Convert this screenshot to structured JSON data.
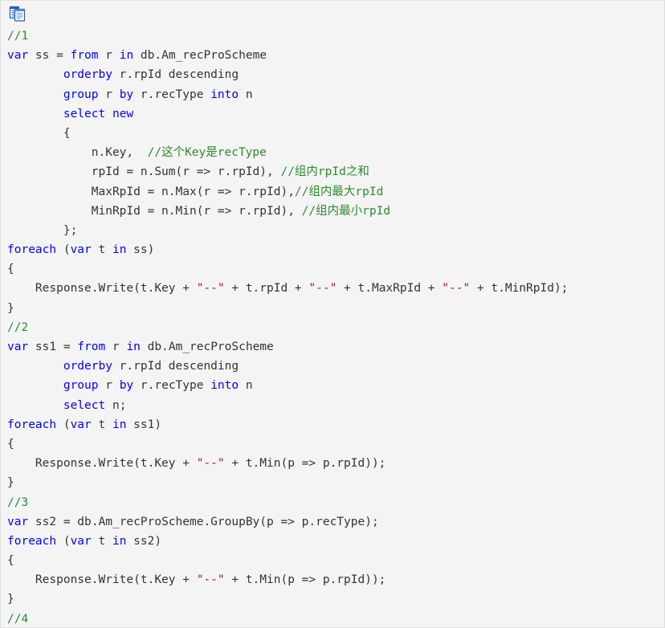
{
  "viewer": {
    "background": "#f4f4f4",
    "border_color": "#dddddd",
    "language": "csharp"
  },
  "toolbar": {
    "copy_icon_name": "copy-to-clipboard-icon",
    "copy_icon_title": "复制代码",
    "accent": "#2a5db0"
  },
  "palette": {
    "keyword": "#0000ff",
    "comment": "#2e8b2e",
    "string": "#a31515",
    "plain": "#333333"
  },
  "code": {
    "lines": [
      [
        {
          "t": "//1",
          "c": "cm"
        }
      ],
      [
        {
          "t": "var",
          "c": "k"
        },
        {
          "t": " ss = ",
          "c": "pl"
        },
        {
          "t": "from",
          "c": "k"
        },
        {
          "t": " r ",
          "c": "pl"
        },
        {
          "t": "in",
          "c": "k"
        },
        {
          "t": " db.Am_recProScheme",
          "c": "pl"
        }
      ],
      [
        {
          "t": "        ",
          "c": "pl"
        },
        {
          "t": "orderby",
          "c": "k"
        },
        {
          "t": " r.rpId descending",
          "c": "pl"
        }
      ],
      [
        {
          "t": "        ",
          "c": "pl"
        },
        {
          "t": "group",
          "c": "k"
        },
        {
          "t": " r ",
          "c": "pl"
        },
        {
          "t": "by",
          "c": "k"
        },
        {
          "t": " r.recType ",
          "c": "pl"
        },
        {
          "t": "into",
          "c": "k"
        },
        {
          "t": " n",
          "c": "pl"
        }
      ],
      [
        {
          "t": "        ",
          "c": "pl"
        },
        {
          "t": "select",
          "c": "k"
        },
        {
          "t": " ",
          "c": "pl"
        },
        {
          "t": "new",
          "c": "k"
        }
      ],
      [
        {
          "t": "        {",
          "c": "pl"
        }
      ],
      [
        {
          "t": "            n.Key,  ",
          "c": "pl"
        },
        {
          "t": "//这个Key是recType",
          "c": "cm"
        }
      ],
      [
        {
          "t": "            rpId = n.Sum(r => r.rpId), ",
          "c": "pl"
        },
        {
          "t": "//组内rpId之和",
          "c": "cm"
        }
      ],
      [
        {
          "t": "            MaxRpId = n.Max(r => r.rpId),",
          "c": "pl"
        },
        {
          "t": "//组内最大rpId",
          "c": "cm"
        }
      ],
      [
        {
          "t": "            MinRpId = n.Min(r => r.rpId), ",
          "c": "pl"
        },
        {
          "t": "//组内最小rpId",
          "c": "cm"
        }
      ],
      [
        {
          "t": "        };",
          "c": "pl"
        }
      ],
      [
        {
          "t": "foreach",
          "c": "k"
        },
        {
          "t": " (",
          "c": "pl"
        },
        {
          "t": "var",
          "c": "k"
        },
        {
          "t": " t ",
          "c": "pl"
        },
        {
          "t": "in",
          "c": "k"
        },
        {
          "t": " ss)",
          "c": "pl"
        }
      ],
      [
        {
          "t": "{",
          "c": "pl"
        }
      ],
      [
        {
          "t": "    Response.Write(t.Key + ",
          "c": "pl"
        },
        {
          "t": "\"--\"",
          "c": "st"
        },
        {
          "t": " + t.rpId + ",
          "c": "pl"
        },
        {
          "t": "\"--\"",
          "c": "st"
        },
        {
          "t": " + t.MaxRpId + ",
          "c": "pl"
        },
        {
          "t": "\"--\"",
          "c": "st"
        },
        {
          "t": " + t.MinRpId);",
          "c": "pl"
        }
      ],
      [
        {
          "t": "}",
          "c": "pl"
        }
      ],
      [
        {
          "t": "//2",
          "c": "cm"
        }
      ],
      [
        {
          "t": "var",
          "c": "k"
        },
        {
          "t": " ss1 = ",
          "c": "pl"
        },
        {
          "t": "from",
          "c": "k"
        },
        {
          "t": " r ",
          "c": "pl"
        },
        {
          "t": "in",
          "c": "k"
        },
        {
          "t": " db.Am_recProScheme",
          "c": "pl"
        }
      ],
      [
        {
          "t": "        ",
          "c": "pl"
        },
        {
          "t": "orderby",
          "c": "k"
        },
        {
          "t": " r.rpId descending",
          "c": "pl"
        }
      ],
      [
        {
          "t": "        ",
          "c": "pl"
        },
        {
          "t": "group",
          "c": "k"
        },
        {
          "t": " r ",
          "c": "pl"
        },
        {
          "t": "by",
          "c": "k"
        },
        {
          "t": " r.recType ",
          "c": "pl"
        },
        {
          "t": "into",
          "c": "k"
        },
        {
          "t": " n",
          "c": "pl"
        }
      ],
      [
        {
          "t": "        ",
          "c": "pl"
        },
        {
          "t": "select",
          "c": "k"
        },
        {
          "t": " n;",
          "c": "pl"
        }
      ],
      [
        {
          "t": "foreach",
          "c": "k"
        },
        {
          "t": " (",
          "c": "pl"
        },
        {
          "t": "var",
          "c": "k"
        },
        {
          "t": " t ",
          "c": "pl"
        },
        {
          "t": "in",
          "c": "k"
        },
        {
          "t": " ss1)",
          "c": "pl"
        }
      ],
      [
        {
          "t": "{",
          "c": "pl"
        }
      ],
      [
        {
          "t": "    Response.Write(t.Key + ",
          "c": "pl"
        },
        {
          "t": "\"--\"",
          "c": "st"
        },
        {
          "t": " + t.Min(p => p.rpId));",
          "c": "pl"
        }
      ],
      [
        {
          "t": "}",
          "c": "pl"
        }
      ],
      [
        {
          "t": "//3",
          "c": "cm"
        }
      ],
      [
        {
          "t": "var",
          "c": "k"
        },
        {
          "t": " ss2 = db.Am_recProScheme.GroupBy(p => p.recType);",
          "c": "pl"
        }
      ],
      [
        {
          "t": "foreach",
          "c": "k"
        },
        {
          "t": " (",
          "c": "pl"
        },
        {
          "t": "var",
          "c": "k"
        },
        {
          "t": " t ",
          "c": "pl"
        },
        {
          "t": "in",
          "c": "k"
        },
        {
          "t": " ss2)",
          "c": "pl"
        }
      ],
      [
        {
          "t": "{",
          "c": "pl"
        }
      ],
      [
        {
          "t": "    Response.Write(t.Key + ",
          "c": "pl"
        },
        {
          "t": "\"--\"",
          "c": "st"
        },
        {
          "t": " + t.Min(p => p.rpId));",
          "c": "pl"
        }
      ],
      [
        {
          "t": "}",
          "c": "pl"
        }
      ],
      [
        {
          "t": "//4",
          "c": "cm"
        }
      ]
    ]
  }
}
